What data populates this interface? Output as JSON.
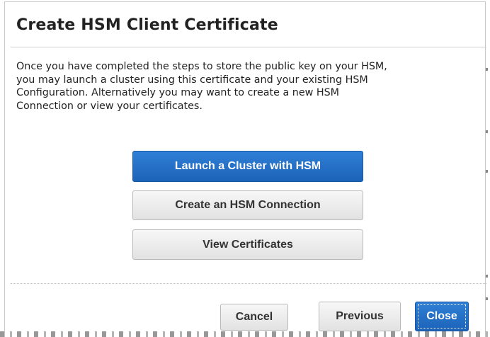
{
  "dialog": {
    "title": "Create HSM Client Certificate",
    "body_lines": [
      "Once you have completed the steps to store the public key on your HSM,",
      "you may launch a cluster using this certificate and your existing HSM",
      "Configuration. Alternatively you may want to create a new HSM",
      "Connection or view your certificates."
    ],
    "actions": {
      "launch_label": "Launch a Cluster with HSM",
      "create_connection_label": "Create an HSM Connection",
      "view_certificates_label": "View Certificates"
    },
    "footer": {
      "cancel_label": "Cancel",
      "previous_label": "Previous",
      "close_label": "Close"
    }
  },
  "colors": {
    "primary": "#1c63b8",
    "secondary": "#e2e2e2",
    "text": "#222222"
  }
}
